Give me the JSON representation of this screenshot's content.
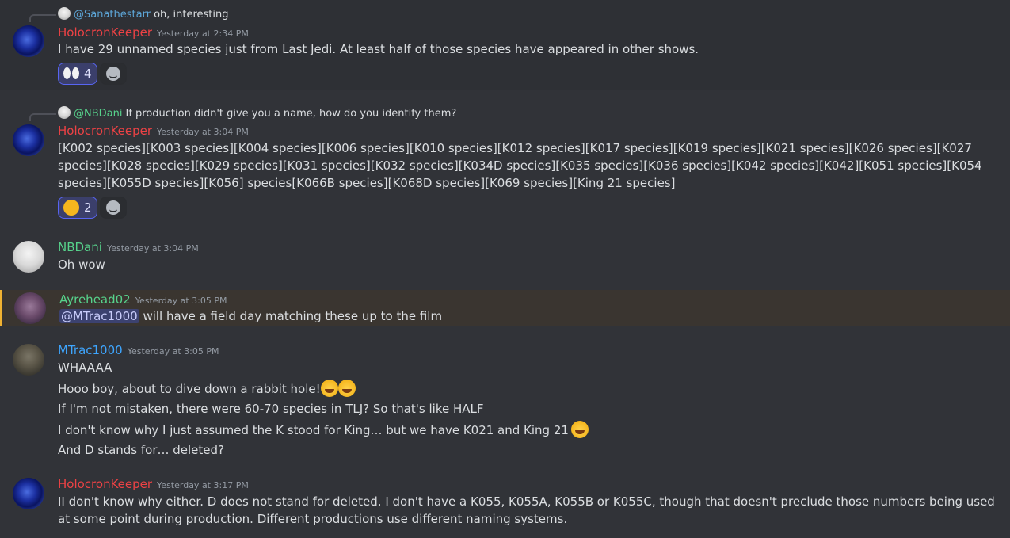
{
  "messages": [
    {
      "reply": {
        "name": "@Sanathestarr",
        "text": "oh, interesting"
      },
      "author": "HolocronKeeper",
      "timestamp": "Yesterday at 2:34 PM",
      "lines": [
        "I have 29 unnamed species just from Last Jedi. At least half of those species have appeared in other shows."
      ],
      "reaction": {
        "emoji": "eyes-emoji",
        "count": "4"
      }
    },
    {
      "reply": {
        "name": "@NBDani",
        "text": "If production didn't give you a name, how do you identify them?"
      },
      "author": "HolocronKeeper",
      "timestamp": "Yesterday at 3:04 PM",
      "lines": [
        "[K002 species][K003 species][K004 species][K006 species][K010 species][K012 species][K017 species][K019 species][K021 species][K026 species][K027 species][K028 species][K029 species][K031 species][K032 species][K034D species][K035 species][K036 species][K042 species][K042][K051 species][K054 species][K055D species][K056] species[K066B species][K068D species][K069 species][King 21 species]"
      ],
      "reaction": {
        "emoji": "dizzy-face-emoji",
        "count": "2"
      }
    },
    {
      "author": "NBDani",
      "timestamp": "Yesterday at 3:04 PM",
      "lines": [
        "Oh wow"
      ]
    },
    {
      "author": "Ayrehead02",
      "timestamp": "Yesterday at 3:05 PM",
      "mention": "@MTrac1000",
      "lines": [
        " will have a field day matching these up to the film"
      ]
    },
    {
      "author": "MTrac1000",
      "timestamp": "Yesterday at 3:05 PM",
      "lines": [
        "WHAAAA",
        "Hooo boy, about to dive down a rabbit hole!",
        "If I'm not mistaken, there were 60-70 species in TLJ? So that's like HALF",
        "I don't know why I just assumed the K stood for King… but we have K021 and King 21",
        "And D stands for… deleted?"
      ]
    },
    {
      "author": "HolocronKeeper",
      "timestamp": "Yesterday at 3:17 PM",
      "lines": [
        "II don't know why either. D does not stand for deleted.  I don't have a K055, K055A, K055B or K055C, though that doesn't preclude those numbers being used at some point during production. Different productions use different naming systems."
      ]
    }
  ],
  "colors": {
    "holocronkeeper": "#ed4245",
    "nbdani": "#57d38c",
    "ayrehead02": "#57d38c",
    "mtrac1000": "#3ea6ff",
    "background": "#313338"
  }
}
